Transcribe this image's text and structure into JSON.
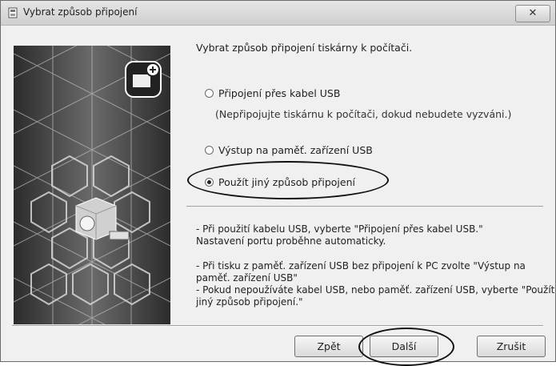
{
  "window": {
    "title": "Vybrat způsob připojení",
    "close_label": "✕"
  },
  "main": {
    "heading": "Vybrat způsob připojení tiskárny k počítači.",
    "options": [
      {
        "label": "Připojení přes kabel USB",
        "selected": false
      },
      {
        "label": "Výstup na paměť. zařízení USB",
        "selected": false
      },
      {
        "label": "Použít jiný způsob připojení",
        "selected": true
      }
    ],
    "usb_note": "(Nepřipojujte tiskárnu k počítači, dokud nebudete vyzváni.)",
    "info": [
      "- Při použití kabelu USB, vyberte \"Připojení přes kabel USB.\"",
      "Nastavení portu proběhne automaticky.",
      "- Při tisku z paměť. zařízení USB bez připojení k PC zvolte \"Výstup na",
      "paměť. zařízení USB\"",
      "- Pokud nepoužíváte kabel USB, nebo paměť. zařízení USB, vyberte \"Použít",
      "jiný způsob připojení.\""
    ]
  },
  "buttons": {
    "back": "Zpět",
    "next": "Další",
    "cancel": "Zrušit"
  },
  "colors": {
    "window_bg": "#f0f0f0",
    "annotation": "#111111"
  }
}
